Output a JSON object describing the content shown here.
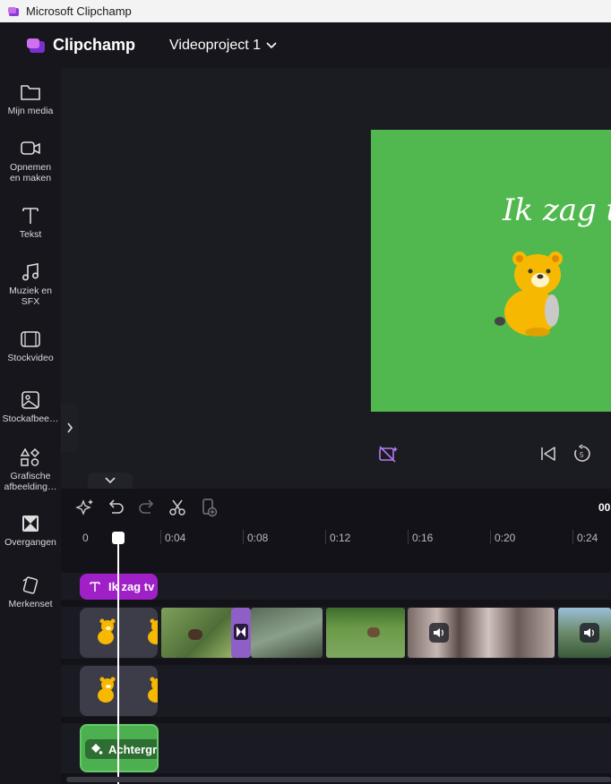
{
  "window": {
    "title": "Microsoft Clipchamp"
  },
  "header": {
    "brand": "Clipchamp",
    "project_name": "Videoproject 1"
  },
  "sidebar": {
    "items": [
      {
        "label": "Mijn media",
        "icon": "folder-icon"
      },
      {
        "label": "Opnemen en maken",
        "icon": "camera-icon"
      },
      {
        "label": "Tekst",
        "icon": "text-icon"
      },
      {
        "label": "Muziek en SFX",
        "icon": "music-icon"
      },
      {
        "label": "Stockvideo",
        "icon": "film-icon"
      },
      {
        "label": "Stockafbee…",
        "icon": "image-icon"
      },
      {
        "label": "Grafische afbeelding…",
        "icon": "shapes-icon"
      },
      {
        "label": "Overgangen",
        "icon": "transition-icon"
      },
      {
        "label": "Merkenset",
        "icon": "brand-kit-icon"
      }
    ]
  },
  "preview": {
    "text": "Ik zag tw"
  },
  "timeline": {
    "time_partial": "00",
    "ruler": [
      "0",
      "0:04",
      "0:08",
      "0:12",
      "0:16",
      "0:20",
      "0:24"
    ],
    "text_clip": "Ik zag tv",
    "background_clip": "Achtergr"
  },
  "colors": {
    "accent": "#a020c8",
    "canvas": "#50b84e",
    "background_clip": "#4caf50"
  }
}
